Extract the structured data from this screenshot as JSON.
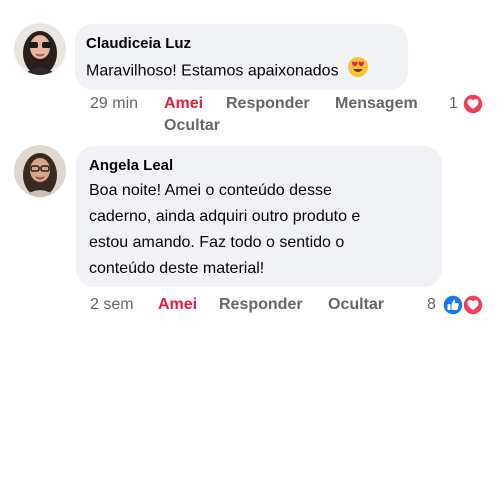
{
  "comments": [
    {
      "author": "Claudiceia Luz",
      "text": "Maravilhoso! Estamos apaixonados",
      "time": "29 min",
      "like_label": "Amei",
      "reply_label": "Responder",
      "message_label": "Mensagem",
      "hide_label": "Ocultar",
      "reaction_count": "1",
      "reactions": [
        "love-icon"
      ],
      "emoji": "heart-eyes-emoji"
    },
    {
      "author": "Angela Leal",
      "text_lines": [
        "Boa noite! Amei o conteúdo desse",
        "caderno, ainda adquiri outro produto e",
        "estou amando. Faz todo o sentido o",
        "conteúdo deste material!"
      ],
      "time": "2 sem",
      "like_label": "Amei",
      "reply_label": "Responder",
      "hide_label": "Ocultar",
      "reaction_count": "8",
      "reactions": [
        "like-icon",
        "love-icon"
      ]
    }
  ],
  "colors": {
    "bubble": "#f0f2f5",
    "meta": "#65676b",
    "love": "#f33e58",
    "like": "#1877f2",
    "liked_text": "#e41e3f"
  }
}
